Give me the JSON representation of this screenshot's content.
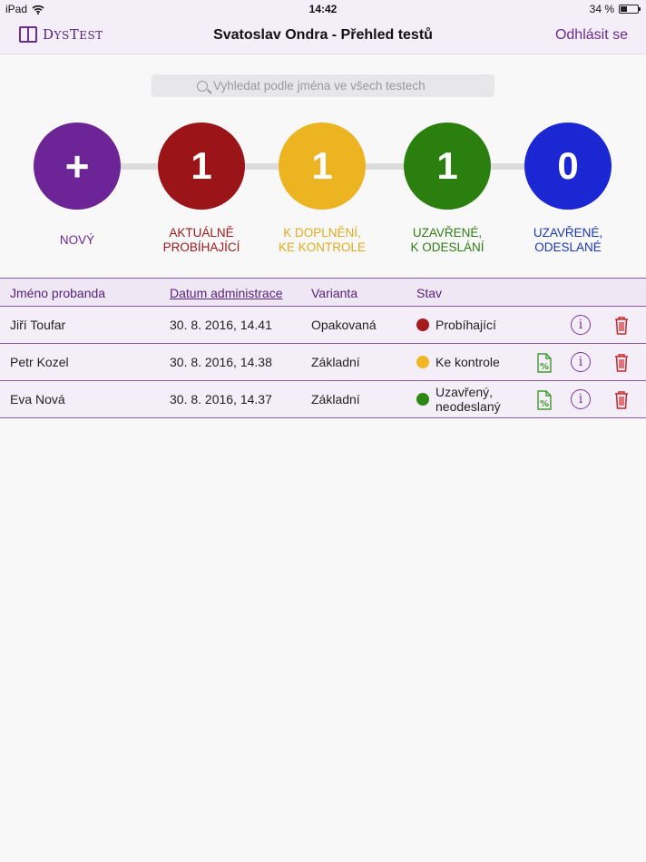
{
  "status_bar": {
    "device": "iPad",
    "time": "14:42",
    "battery": "34 %",
    "battery_level": 0.34
  },
  "nav": {
    "logo_prefix": "D",
    "logo_small1": "YS",
    "logo_mid": "T",
    "logo_small2": "EST",
    "title": "Svatoslav Ondra - Přehled testů",
    "logout": "Odhlásit se"
  },
  "search": {
    "placeholder": "Vyhledat podle jména ve všech testech"
  },
  "stages": {
    "new": {
      "symbol": "+",
      "label_line1": "Nový",
      "label_line2": "",
      "color": "#6c2496"
    },
    "running": {
      "count": "1",
      "label_line1": "Aktuálně",
      "label_line2": "probíhající",
      "color": "#9b1418"
    },
    "check": {
      "count": "1",
      "label_line1": "K doplnění,",
      "label_line2": "ke kontrole",
      "color": "#ebb420"
    },
    "closed": {
      "count": "1",
      "label_line1": "Uzavřené,",
      "label_line2": "k odeslání",
      "color": "#2b7f0f"
    },
    "sent": {
      "count": "0",
      "label_line1": "Uzavřené,",
      "label_line2": "odeslané",
      "color": "#1a27d2"
    }
  },
  "table": {
    "headers": {
      "name": "Jméno probanda",
      "date": "Datum administrace",
      "variant": "Varianta",
      "status": "Stav"
    },
    "rows": [
      {
        "name": "Jiří Toufar",
        "date": "30. 8. 2016, 14.41",
        "variant": "Opakovaná",
        "status_line1": "Probíhající",
        "status_line2": "",
        "status_color": "#a51a1c"
      },
      {
        "name": "Petr Kozel",
        "date": "30. 8. 2016, 14.38",
        "variant": "Základní",
        "status_line1": "Ke kontrole",
        "status_line2": "",
        "status_color": "#f0b625"
      },
      {
        "name": "Eva Nová",
        "date": "30. 8. 2016, 14.37",
        "variant": "Základní",
        "status_line1": "Uzavřený,",
        "status_line2": "neodeslaný",
        "status_color": "#2e8714"
      }
    ]
  },
  "icons": {
    "wifi": "wifi-icon",
    "battery": "battery-icon",
    "logo": "book-icon",
    "search": "search-icon",
    "report": "percent-document-icon",
    "info": "info-icon",
    "delete": "trash-icon"
  },
  "colors": {
    "accent": "#6a2d91",
    "report_icon": "#3f9a2a",
    "delete_icon": "#c9262a"
  }
}
